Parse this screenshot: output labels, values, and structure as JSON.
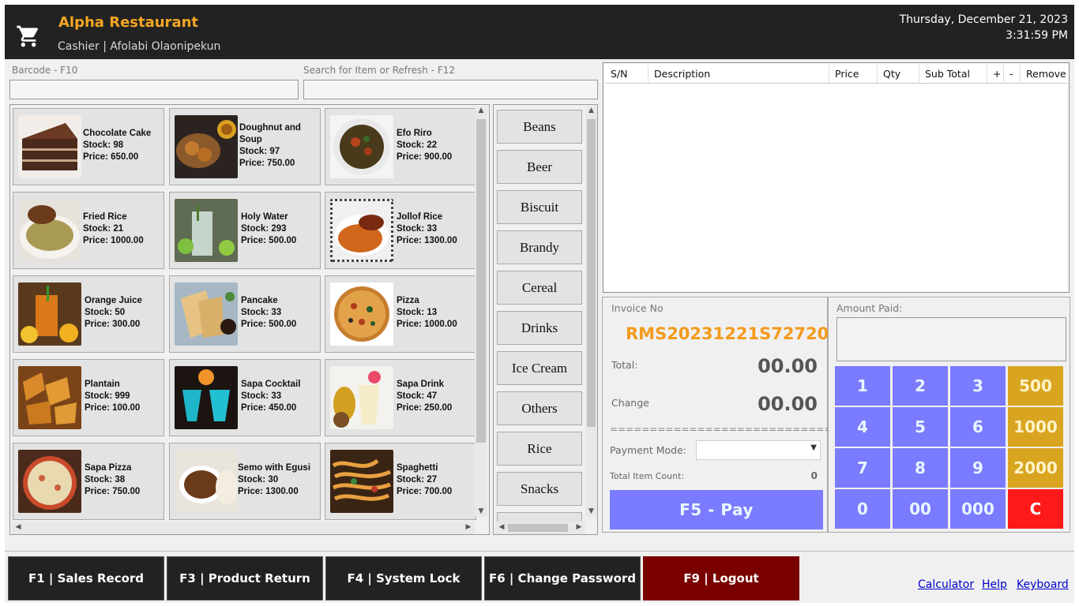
{
  "header": {
    "brand": "Alpha Restaurant",
    "cashier": "Cashier | Afolabi Olaonipekun",
    "date": "Thursday, December 21, 2023",
    "time": "3:31:59 PM",
    "icon": "shopping-cart-icon"
  },
  "inputs": {
    "barcode_label": "Barcode - F10",
    "barcode_value": "",
    "search_label": "Search for Item or Refresh - F12",
    "search_value": ""
  },
  "items": [
    {
      "name": "Chocolate Cake",
      "stock": "Stock: 98",
      "price": "Price: 650.00"
    },
    {
      "name": "Doughnut and Soup",
      "stock": "Stock: 97",
      "price": "Price: 750.00"
    },
    {
      "name": "Efo Riro",
      "stock": "Stock: 22",
      "price": "Price: 900.00"
    },
    {
      "name": "Fried Rice",
      "stock": "Stock: 21",
      "price": "Price: 1000.00"
    },
    {
      "name": "Holy Water",
      "stock": "Stock: 293",
      "price": "Price: 500.00"
    },
    {
      "name": "Jollof Rice",
      "stock": "Stock: 33",
      "price": "Price: 1300.00"
    },
    {
      "name": "Orange Juice",
      "stock": "Stock: 50",
      "price": "Price: 300.00"
    },
    {
      "name": "Pancake",
      "stock": "Stock: 33",
      "price": "Price: 500.00"
    },
    {
      "name": "Pizza",
      "stock": "Stock: 13",
      "price": "Price: 1000.00"
    },
    {
      "name": "Plantain",
      "stock": "Stock: 999",
      "price": "Price: 100.00"
    },
    {
      "name": "Sapa Cocktail",
      "stock": "Stock: 33",
      "price": "Price: 450.00"
    },
    {
      "name": "Sapa Drink",
      "stock": "Stock: 47",
      "price": "Price: 250.00"
    },
    {
      "name": "Sapa Pizza",
      "stock": "Stock: 38",
      "price": "Price: 750.00"
    },
    {
      "name": "Semo with Egusi",
      "stock": "Stock: 30",
      "price": "Price: 1300.00"
    },
    {
      "name": "Spaghetti",
      "stock": "Stock: 27",
      "price": "Price: 700.00"
    }
  ],
  "categories": [
    "Beans",
    "Beer",
    "Biscuit",
    "Brandy",
    "Cereal",
    "Drinks",
    "Ice Cream",
    "Others",
    "Rice",
    "Snacks"
  ],
  "cart": {
    "columns": [
      "S/N",
      "Description",
      "Price",
      "Qty",
      "Sub Total",
      "+",
      "-",
      "Remove"
    ],
    "rows": []
  },
  "invoice": {
    "invoice_label": "Invoice No",
    "invoice_no": "RMS20231221S72720",
    "total_label": "Total:",
    "total_value": "00.00",
    "change_label": "Change",
    "change_value": "00.00",
    "separator": "==============================",
    "payment_mode_label": "Payment Mode:",
    "payment_mode_value": "",
    "item_count_label": "Total Item Count:",
    "item_count_value": "0",
    "pay_label": "F5 - Pay"
  },
  "keypad": {
    "amount_label": "Amount Paid:",
    "amount_value": "",
    "keys": [
      "1",
      "2",
      "3",
      "500",
      "4",
      "5",
      "6",
      "1000",
      "7",
      "8",
      "9",
      "2000",
      "0",
      "00",
      "000",
      "C"
    ]
  },
  "footer": {
    "buttons": [
      "F1 | Sales Record",
      "F3 | Product Return",
      "F4 | System Lock",
      "F6 | Change Password",
      "F9 | Logout"
    ],
    "links": [
      "Calculator",
      "Help",
      "Keyboard"
    ]
  },
  "colors": {
    "brand": "#f5a623",
    "invoice_no": "#f39a1c",
    "keypad_number": "#7b7bff",
    "keypad_amount": "#d9a520",
    "keypad_clear": "#ff1a1a",
    "logout": "#7a0000",
    "header_bg": "#222222"
  }
}
